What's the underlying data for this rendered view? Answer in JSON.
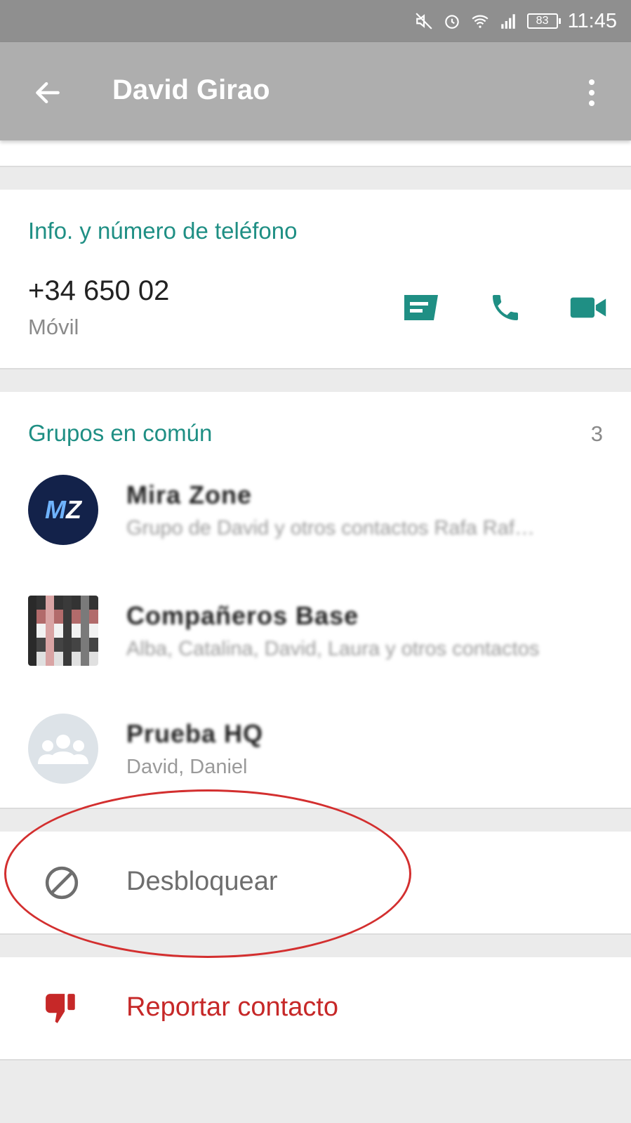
{
  "status_bar": {
    "battery": "83",
    "time": "11:45",
    "icons": [
      "mute-icon",
      "alarm-icon",
      "wifi-icon",
      "signal-icon",
      "battery-icon"
    ]
  },
  "app_bar": {
    "title": "David Girao",
    "back_icon": "arrow-left-icon",
    "menu_icon": "more-vertical-icon"
  },
  "info": {
    "title": "Info. y número de teléfono",
    "phone": "+34 650 02",
    "phone_type": "Móvil",
    "actions": [
      "message-icon",
      "phone-icon",
      "video-icon"
    ]
  },
  "groups": {
    "title": "Grupos en común",
    "count": "3",
    "items": [
      {
        "name": "Mira Zone",
        "members": "Grupo de David y otros contactos Rafa Raf…",
        "avatar": "MZ"
      },
      {
        "name": "Compañeros Base",
        "members": "Alba, Catalina, David, Laura y otros contactos",
        "avatar": ""
      },
      {
        "name": "Prueba HQ",
        "members": "David, Daniel",
        "avatar": "group-icon"
      }
    ]
  },
  "unblock": {
    "label": "Desbloquear",
    "icon": "block-icon"
  },
  "report": {
    "label": "Reportar contacto",
    "icon": "thumbs-down-icon"
  },
  "colors": {
    "accent": "#1f8f84",
    "report": "#c62828",
    "app_bar": "#aeaeae",
    "status_bar": "#8f8f8f",
    "annotation": "#d32f2f"
  }
}
